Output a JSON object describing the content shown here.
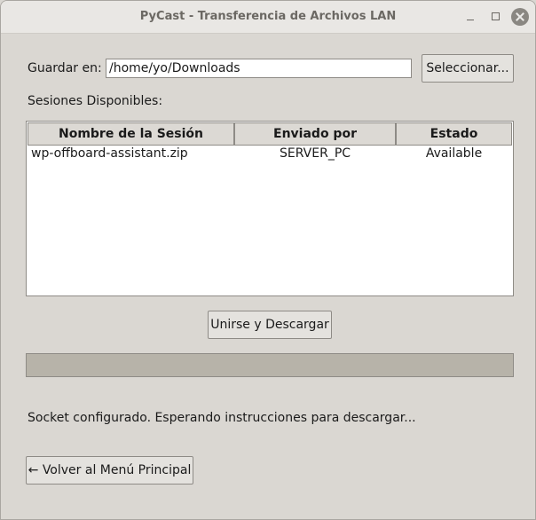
{
  "window": {
    "title": "PyCast - Transferencia de Archivos LAN"
  },
  "download": {
    "save_label": "Guardar en:",
    "save_path": "/home/yo/Downloads",
    "browse_label": "Seleccionar..."
  },
  "sessions": {
    "label": "Sesiones Disponibles:",
    "columns": [
      "Nombre de la Sesión",
      "Enviado por",
      "Estado"
    ],
    "rows": [
      [
        "wp-offboard-assistant.zip",
        "SERVER_PC",
        "Available"
      ]
    ]
  },
  "actions": {
    "join_label": "Unirse y Descargar",
    "back_label": "← Volver al Menú Principal"
  },
  "progress": {
    "value": 0
  },
  "status": {
    "text": "Socket configurado. Esperando instrucciones para descargar..."
  },
  "colors": {
    "window_bg": "#dad7d2",
    "progress_trough": "#b7b3a9"
  }
}
